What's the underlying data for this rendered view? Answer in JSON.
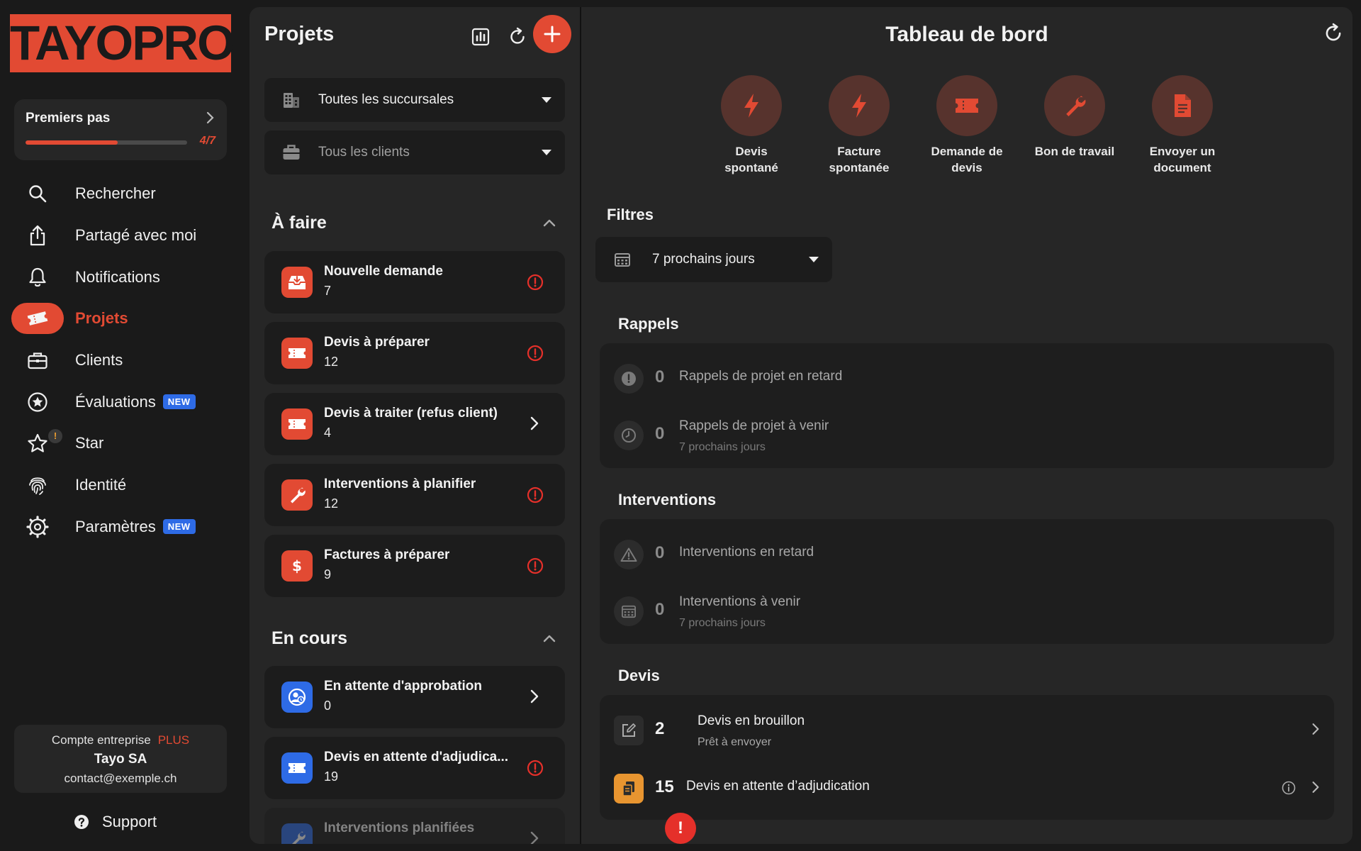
{
  "brand": {
    "logo_text": "TAYOPRO",
    "accent": "#e24a33"
  },
  "getting_started": {
    "title": "Premiers pas",
    "progress_text": "4/7",
    "progress_fraction": 0.57
  },
  "nav": {
    "items": [
      {
        "label": "Rechercher",
        "icon": "search-icon"
      },
      {
        "label": "Partagé avec moi",
        "icon": "share-icon"
      },
      {
        "label": "Notifications",
        "icon": "bell-icon"
      },
      {
        "label": "Projets",
        "icon": "ticket-icon",
        "active": true
      },
      {
        "label": "Clients",
        "icon": "briefcase-icon"
      },
      {
        "label": "Évaluations",
        "icon": "star-circle-icon",
        "badge": "NEW"
      },
      {
        "label": "Star",
        "icon": "star-icon",
        "alert": "!"
      },
      {
        "label": "Identité",
        "icon": "fingerprint-icon"
      },
      {
        "label": "Paramètres",
        "icon": "gear-icon",
        "badge": "NEW"
      }
    ]
  },
  "account": {
    "type_label": "Compte entreprise",
    "plan": "PLUS",
    "company": "Tayo SA",
    "email": "contact@exemple.ch"
  },
  "support": {
    "label": "Support"
  },
  "projects": {
    "title": "Projets",
    "filters": {
      "branch": "Toutes les succursales",
      "client_placeholder": "Tous les clients"
    },
    "todo": {
      "title": "À faire",
      "items": [
        {
          "title": "Nouvelle demande",
          "count": "7"
        },
        {
          "title": "Devis à préparer",
          "count": "12"
        },
        {
          "title": "Devis à traiter (refus client)",
          "count": "4"
        },
        {
          "title": "Interventions à planifier",
          "count": "12"
        },
        {
          "title": "Factures à préparer",
          "count": "9"
        }
      ]
    },
    "in_progress": {
      "title": "En cours",
      "items": [
        {
          "title": "En attente d'approbation",
          "count": "0"
        },
        {
          "title": "Devis en attente d'adjudica...",
          "count": "19"
        },
        {
          "title": "Interventions planifiées"
        }
      ]
    }
  },
  "dashboard": {
    "title": "Tableau de bord",
    "quick_actions": [
      {
        "label": "Devis spontané",
        "icon": "bolt-icon"
      },
      {
        "label": "Facture spontanée",
        "icon": "bolt-icon"
      },
      {
        "label": "Demande de devis",
        "icon": "ticket-icon"
      },
      {
        "label": "Bon de travail",
        "icon": "wrench-icon"
      },
      {
        "label": "Envoyer un document",
        "icon": "document-icon"
      }
    ],
    "filters": {
      "title": "Filtres",
      "period": "7 prochains jours"
    },
    "reminders": {
      "title": "Rappels",
      "late": {
        "count": "0",
        "label": "Rappels de projet en retard"
      },
      "upcoming": {
        "count": "0",
        "label": "Rappels de projet à venir",
        "sub": "7 prochains jours"
      }
    },
    "interventions": {
      "title": "Interventions",
      "late": {
        "count": "0",
        "label": "Interventions en retard"
      },
      "upcoming": {
        "count": "0",
        "label": "Interventions à venir",
        "sub": "7 prochains jours"
      }
    },
    "quotes": {
      "title": "Devis",
      "draft": {
        "count": "2",
        "label": "Devis en brouillon",
        "sub": "Prêt à envoyer"
      },
      "pending": {
        "count": "15",
        "label": "Devis en attente d’adjudication"
      }
    },
    "alert_fab": "!"
  }
}
